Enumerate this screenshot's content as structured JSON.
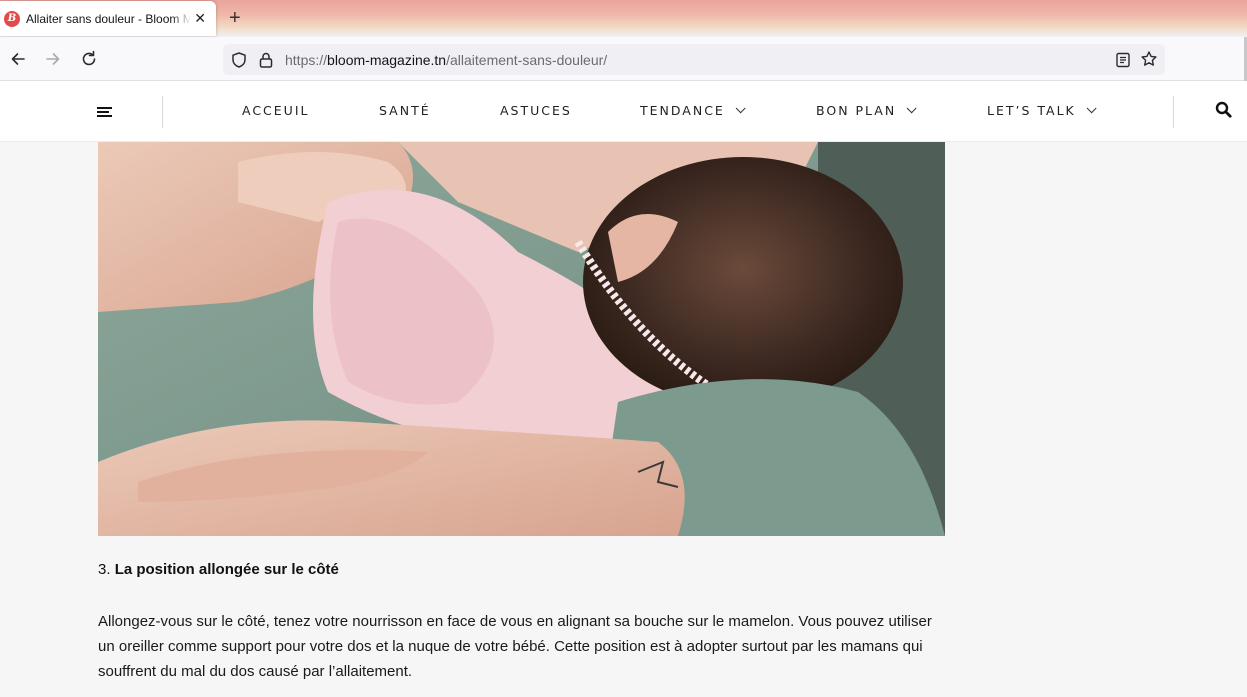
{
  "browser": {
    "tab": {
      "favicon_letter": "B",
      "title": "Allaiter sans douleur - Bloom Magazine",
      "close_glyph": "✕"
    },
    "new_tab_glyph": "+",
    "url": {
      "protocol": "https://",
      "domain": "bloom-magazine.tn",
      "path": "/allaitement-sans-douleur/"
    },
    "icons": [
      "back-arrow-icon",
      "forward-arrow-icon",
      "reload-icon",
      "shield-icon",
      "lock-icon",
      "reader-view-icon",
      "bookmark-star-icon"
    ]
  },
  "site": {
    "nav": [
      {
        "label": "ACCEUIL",
        "dropdown": false
      },
      {
        "label": "SANTÉ",
        "dropdown": false
      },
      {
        "label": "ASTUCES",
        "dropdown": false
      },
      {
        "label": "TENDANCE",
        "dropdown": true
      },
      {
        "label": "BON PLAN",
        "dropdown": true
      },
      {
        "label": "LET’S TALK",
        "dropdown": true
      }
    ],
    "icons": [
      "menu-icon",
      "search-icon",
      "chevron-down-icon"
    ]
  },
  "article": {
    "heading_number": "3.",
    "heading": "La position allongée sur le côté",
    "paragraph": "Allongez-vous sur le côté, tenez votre nourrisson en face de vous en alignant sa bouche sur le mamelon. Vous pouvez utiliser un oreiller comme support pour votre dos et la nuque de votre bébé. Cette position est à adopter surtout par les mamans qui souffrent du mal du dos causé par l’allaitement."
  },
  "colors": {
    "favicon": "#e14b4b",
    "tab_strip": "#eaa49c",
    "page_background": "#f6f6f6"
  }
}
